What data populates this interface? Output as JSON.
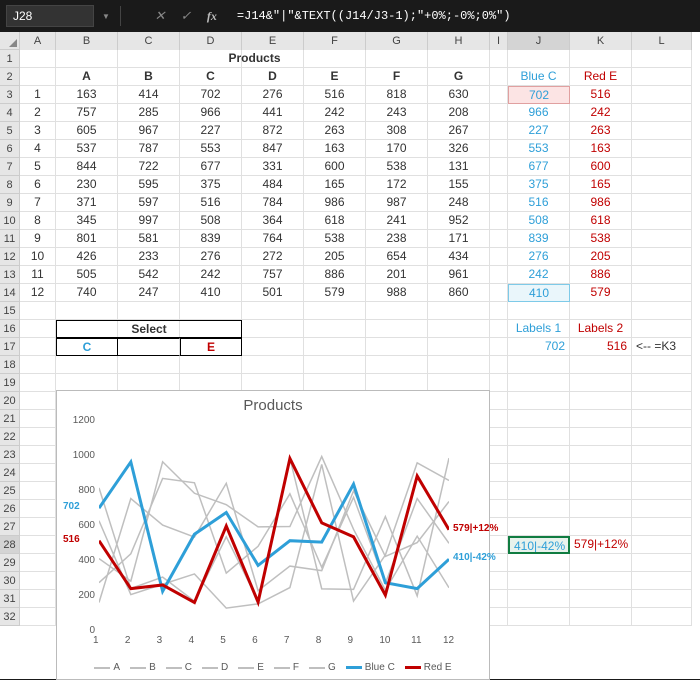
{
  "formula_bar": {
    "cell_ref": "J28",
    "formula": "=J14&\"|\"&TEXT((J14/J3-1);\"+0%;-0%;0%\")"
  },
  "columns": [
    "A",
    "B",
    "C",
    "D",
    "E",
    "F",
    "G",
    "H",
    "I",
    "J",
    "K",
    "L"
  ],
  "col_widths": {
    "A": 36,
    "B": 62,
    "C": 62,
    "D": 62,
    "E": 62,
    "F": 62,
    "G": 62,
    "H": 62,
    "I": 18,
    "J": 62,
    "K": 62,
    "L": 60
  },
  "row_count": 32,
  "merged_title": {
    "text": "Products",
    "row": 1,
    "cols": "A:H"
  },
  "headers_row2": {
    "col_labels": [
      "A",
      "B",
      "C",
      "D",
      "E",
      "F",
      "G"
    ],
    "J": "Blue C",
    "K": "Red E"
  },
  "data_rows": [
    {
      "idx": 1,
      "vals": [
        163,
        414,
        702,
        276,
        516,
        818,
        630
      ],
      "J": 702,
      "K": 516
    },
    {
      "idx": 2,
      "vals": [
        757,
        285,
        966,
        441,
        242,
        243,
        208
      ],
      "J": 966,
      "K": 242
    },
    {
      "idx": 3,
      "vals": [
        605,
        967,
        227,
        872,
        263,
        308,
        267
      ],
      "J": 227,
      "K": 263
    },
    {
      "idx": 4,
      "vals": [
        537,
        787,
        553,
        847,
        163,
        170,
        326
      ],
      "J": 553,
      "K": 163
    },
    {
      "idx": 5,
      "vals": [
        844,
        722,
        677,
        331,
        600,
        538,
        131
      ],
      "J": 677,
      "K": 600
    },
    {
      "idx": 6,
      "vals": [
        230,
        595,
        375,
        484,
        165,
        172,
        155
      ],
      "J": 375,
      "K": 165
    },
    {
      "idx": 7,
      "vals": [
        371,
        597,
        516,
        784,
        986,
        987,
        248
      ],
      "J": 516,
      "K": 986
    },
    {
      "idx": 8,
      "vals": [
        345,
        997,
        508,
        364,
        618,
        241,
        952
      ],
      "J": 508,
      "K": 618
    },
    {
      "idx": 9,
      "vals": [
        801,
        581,
        839,
        764,
        538,
        238,
        171
      ],
      "J": 839,
      "K": 538
    },
    {
      "idx": 10,
      "vals": [
        426,
        233,
        276,
        272,
        205,
        654,
        434
      ],
      "J": 276,
      "K": 205
    },
    {
      "idx": 11,
      "vals": [
        505,
        542,
        242,
        757,
        886,
        201,
        961
      ],
      "J": 242,
      "K": 886
    },
    {
      "idx": 12,
      "vals": [
        740,
        247,
        410,
        501,
        579,
        988,
        860
      ],
      "J": 410,
      "K": 579
    }
  ],
  "select_block": {
    "title": "Select",
    "B17": "C",
    "D17": "E"
  },
  "labels_block": {
    "J16": "Labels 1",
    "K16": "Labels 2",
    "J17": 702,
    "K17": 516,
    "L17": "<-- =K3"
  },
  "result_block": {
    "J28": "410|-42%",
    "K28": "579|+12%"
  },
  "chart_data": {
    "type": "line",
    "title": "Products",
    "xlabel": "",
    "ylabel": "",
    "ylim": [
      0,
      1200
    ],
    "yticks": [
      0,
      200,
      400,
      600,
      800,
      1000,
      1200
    ],
    "x": [
      1,
      2,
      3,
      4,
      5,
      6,
      7,
      8,
      9,
      10,
      11,
      12
    ],
    "series": [
      {
        "name": "A",
        "color": "#bfbfbf",
        "values": [
          163,
          757,
          605,
          537,
          844,
          230,
          371,
          345,
          801,
          426,
          505,
          740
        ]
      },
      {
        "name": "B",
        "color": "#bfbfbf",
        "values": [
          414,
          285,
          967,
          787,
          722,
          595,
          597,
          997,
          581,
          233,
          542,
          247
        ]
      },
      {
        "name": "C",
        "color": "#bfbfbf",
        "values": [
          702,
          966,
          227,
          553,
          677,
          375,
          516,
          508,
          839,
          276,
          242,
          410
        ]
      },
      {
        "name": "D",
        "color": "#bfbfbf",
        "values": [
          276,
          441,
          872,
          847,
          331,
          484,
          784,
          364,
          764,
          272,
          757,
          501
        ]
      },
      {
        "name": "E",
        "color": "#bfbfbf",
        "values": [
          516,
          242,
          263,
          163,
          600,
          165,
          986,
          618,
          538,
          205,
          886,
          579
        ]
      },
      {
        "name": "F",
        "color": "#bfbfbf",
        "values": [
          818,
          243,
          308,
          170,
          538,
          172,
          987,
          241,
          238,
          654,
          201,
          988
        ]
      },
      {
        "name": "G",
        "color": "#bfbfbf",
        "values": [
          630,
          208,
          267,
          326,
          131,
          155,
          248,
          952,
          171,
          434,
          961,
          860
        ]
      },
      {
        "name": "Blue C",
        "color": "#2e9fd8",
        "width": 3,
        "values": [
          702,
          966,
          227,
          553,
          677,
          375,
          516,
          508,
          839,
          276,
          242,
          410
        ]
      },
      {
        "name": "Red E",
        "color": "#c00000",
        "width": 3,
        "values": [
          516,
          242,
          263,
          163,
          600,
          165,
          986,
          618,
          538,
          205,
          886,
          579
        ]
      }
    ],
    "data_labels": [
      {
        "text": "702",
        "x": 1,
        "y": 702,
        "color": "#2e9fd8",
        "align": "left"
      },
      {
        "text": "516",
        "x": 1,
        "y": 516,
        "color": "#c00000",
        "align": "left"
      },
      {
        "text": "410|-42%",
        "x": 12,
        "y": 410,
        "color": "#2e9fd8",
        "align": "right"
      },
      {
        "text": "579|+12%",
        "x": 12,
        "y": 579,
        "color": "#c00000",
        "align": "right"
      }
    ]
  }
}
